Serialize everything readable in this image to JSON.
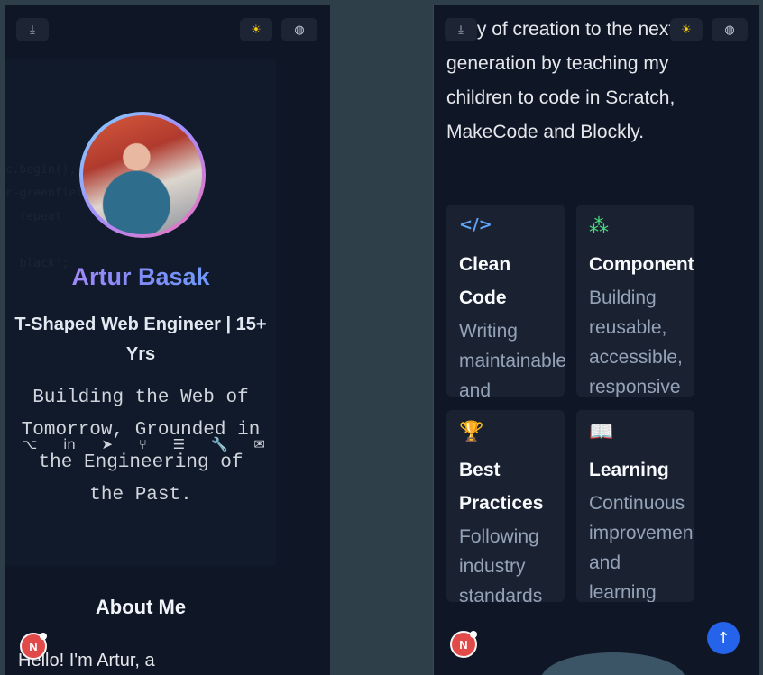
{
  "left": {
    "name": "Artur Basak",
    "role": "T-Shaped Web Engineer | 15+ Yrs",
    "tagline": "Building the Web of Tomorrow, Grounded in the Engineering of the Past.",
    "about_title": "About Me",
    "about_intro": "Hello! I'm Artur, a",
    "code_background": "c.begin(),\nr-greenfield\n  repeat\n\n  black';"
  },
  "right": {
    "paragraph": "d joy of creation to the next generation by teaching my children to code in Scratch, MakeCode and Blockly.",
    "cards": [
      {
        "icon": "</>",
        "title": "Clean Code",
        "desc": "Writing maintainable and"
      },
      {
        "icon": "⁂",
        "title": "Components",
        "desc": "Building reusable, accessible, responsive"
      },
      {
        "icon": "🏆",
        "title": "Best Practices",
        "desc": "Following industry standards"
      },
      {
        "icon": "📖",
        "title": "Learning",
        "desc": "Continuous improvement and learning"
      }
    ]
  },
  "badge_letter": "N",
  "icons": {
    "download": "⤓",
    "sun": "☀",
    "globe": "◍",
    "up": "↑",
    "socials": [
      "⌥",
      "in",
      "➤",
      "⑂",
      "☰",
      "🔧",
      "✉"
    ]
  },
  "colors": {
    "accent_blue": "#2563eb",
    "card_icon_code": "#60a5fa",
    "card_icon_components": "#4ade80",
    "card_icon_trophy": "#facc15",
    "card_icon_book": "#c084fc"
  }
}
